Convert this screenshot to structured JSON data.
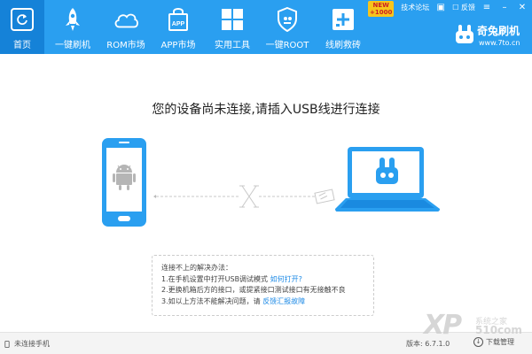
{
  "header": {
    "nav": [
      {
        "label": "首页",
        "icon": "refresh-icon",
        "active": true
      },
      {
        "label": "一键刷机",
        "icon": "rocket-icon"
      },
      {
        "label": "ROM市场",
        "icon": "cloud-icon"
      },
      {
        "label": "APP市场",
        "icon": "app-bag-icon"
      },
      {
        "label": "实用工具",
        "icon": "grid-icon"
      },
      {
        "label": "一键ROOT",
        "icon": "shield-icon"
      },
      {
        "label": "线刷救砖",
        "icon": "repair-icon"
      }
    ],
    "new_badge": {
      "line1": "NEW",
      "line2": "+1000"
    },
    "top_links": {
      "forum": "技术论坛",
      "feedback": "反馈"
    },
    "brand": {
      "name": "奇兔刷机",
      "url": "www.7to.cn"
    }
  },
  "main": {
    "title": "您的设备尚未连接,请插入USB线进行连接",
    "help": {
      "heading": "连接不上的解决办法：",
      "line1_text": "1.在手机设置中打开USB调试模式 ",
      "line1_link": "如何打开?",
      "line2_text": "2.更换机箱后方的接口，或提紧接口测试接口有无接触不良",
      "line3_text": "3.如以上方法不能解决问题，请 ",
      "line3_link": "反馈汇报故障"
    }
  },
  "footer": {
    "status": "未连接手机",
    "version": "版本: 6.7.1.0",
    "download": "下载管理"
  },
  "watermark": {
    "big": "XP",
    "line1": "系统之家",
    "line2": "510com"
  },
  "colors": {
    "header_bg": "#2a9ff0",
    "header_active": "#1582d8",
    "accent": "#2a9ff0",
    "link": "#1d8ae6"
  }
}
